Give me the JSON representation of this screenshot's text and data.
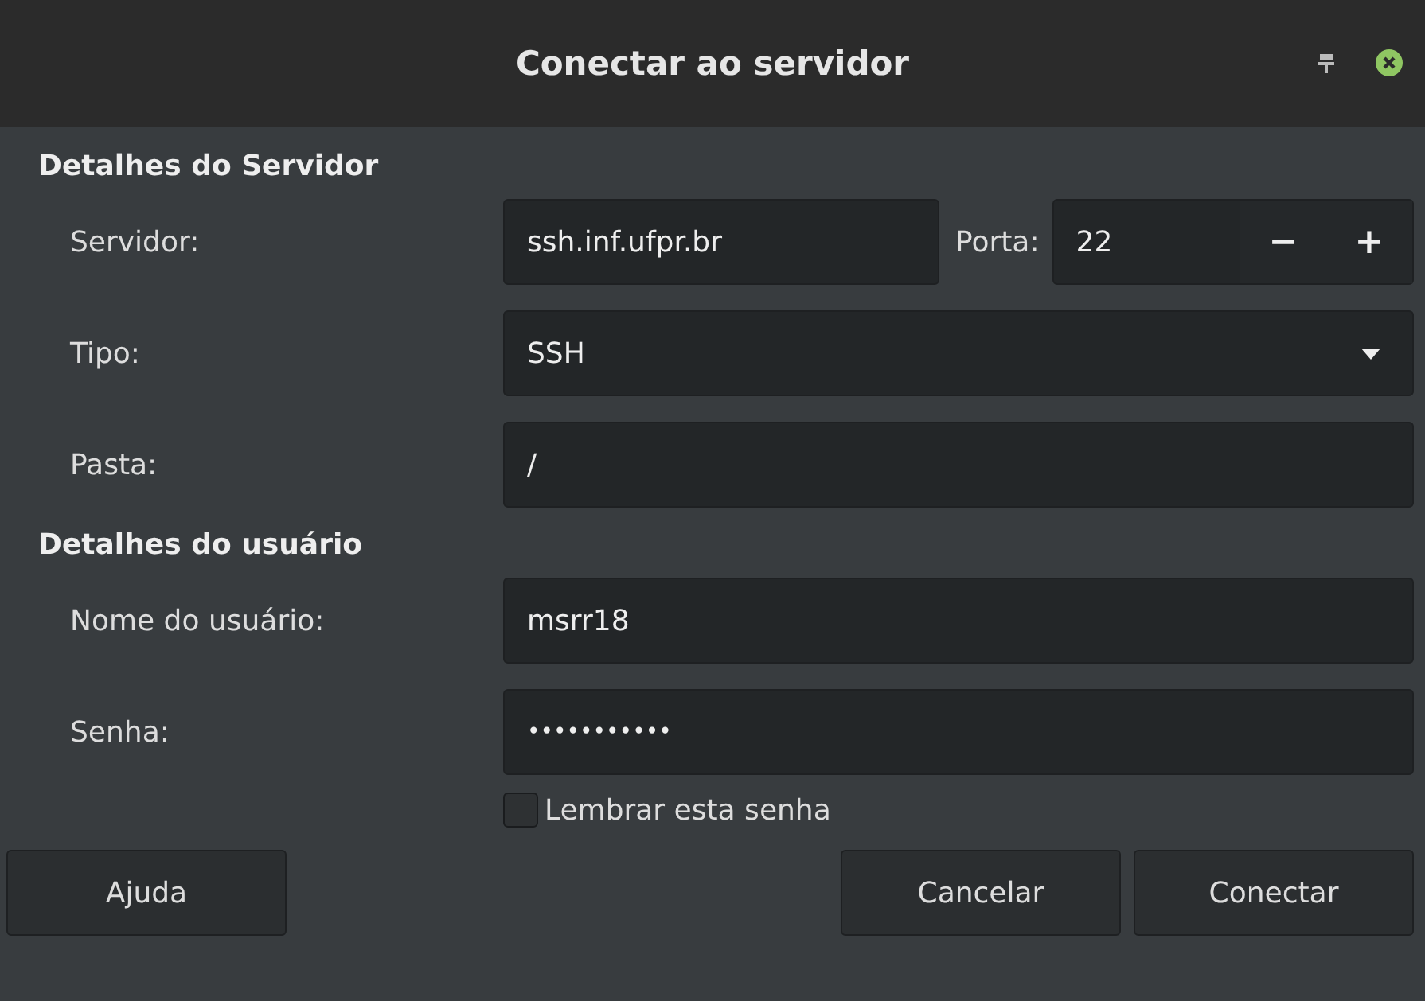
{
  "window": {
    "title": "Conectar ao servidor"
  },
  "sections": [
    {
      "title": "Detalhes do Servidor",
      "rows": [
        {
          "kind": "server",
          "label": "Servidor:",
          "value": "ssh.inf.ufpr.br",
          "port_label": "Porta:",
          "port_value": "22",
          "minus": "−",
          "plus": "+"
        },
        {
          "kind": "dropdown",
          "label": "Tipo:",
          "value": "SSH"
        },
        {
          "kind": "text",
          "label": "Pasta:",
          "value": "/"
        }
      ]
    },
    {
      "title": "Detalhes do usuário",
      "rows": [
        {
          "kind": "text",
          "label": "Nome do usuário:",
          "value": "msrr18"
        },
        {
          "kind": "password",
          "label": "Senha:",
          "value": "•••••••••••"
        }
      ]
    }
  ],
  "remember": {
    "label": "Lembrar esta senha",
    "checked": false
  },
  "buttons": [
    {
      "label": "Ajuda",
      "kind": "help"
    },
    {
      "label": "Cancelar",
      "kind": "action"
    },
    {
      "label": "Conectar",
      "kind": "action"
    }
  ]
}
